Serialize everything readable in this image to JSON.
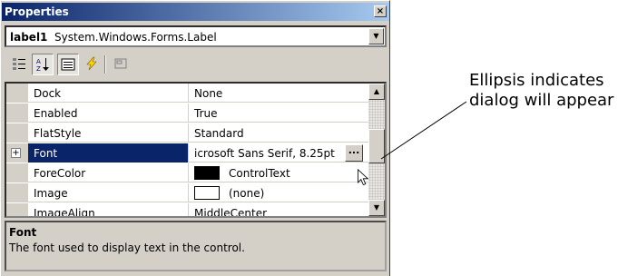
{
  "window": {
    "title": "Properties",
    "close_glyph": "×"
  },
  "object_selector": {
    "object_name": "label1",
    "object_type": "System.Windows.Forms.Label"
  },
  "toolbar": {
    "buttons": [
      {
        "name": "categorized-icon",
        "pressed": false
      },
      {
        "name": "alphabetical-icon",
        "pressed": true
      },
      {
        "name": "properties-icon",
        "pressed": true
      },
      {
        "name": "events-icon",
        "pressed": false
      },
      {
        "name": "property-pages-icon",
        "pressed": false
      }
    ]
  },
  "grid": {
    "rows": [
      {
        "name": "Dock",
        "value": "None"
      },
      {
        "name": "Enabled",
        "value": "True"
      },
      {
        "name": "FlatStyle",
        "value": "Standard"
      },
      {
        "name": "Font",
        "value": "icrosoft Sans Serif, 8.25pt",
        "selected": true,
        "expandable": true,
        "expander": "+",
        "ellipsis": "..."
      },
      {
        "name": "ForeColor",
        "value": "ControlText",
        "swatch": "#000000"
      },
      {
        "name": "Image",
        "value": "(none)",
        "swatch": "#ffffff"
      },
      {
        "name": "ImageAlign",
        "value": "MiddleCenter"
      }
    ]
  },
  "description": {
    "title": "Font",
    "text": "The font used to display text in the control."
  },
  "annotation": {
    "text": "Ellipsis indicates dialog will appear"
  },
  "colors": {
    "title_start": "#0a246a",
    "title_end": "#a6caf0",
    "selection": "#0a246a",
    "face": "#d4d0c8"
  }
}
